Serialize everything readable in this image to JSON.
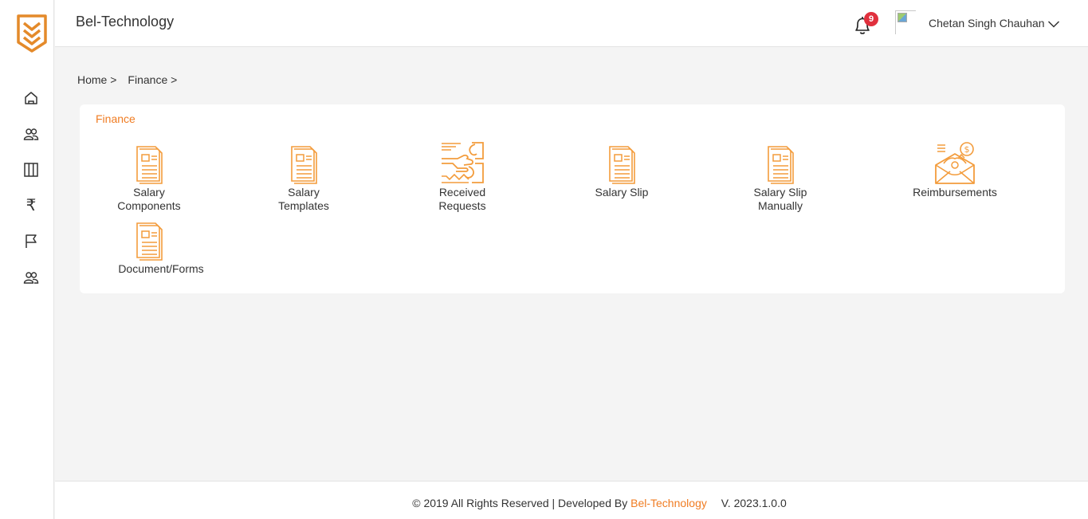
{
  "app": {
    "brand_name": "Bel-Technology",
    "accent_color": "#f07c22",
    "logo_icon": "shield-chevron-logo"
  },
  "sidebar": {
    "items": [
      {
        "name": "home",
        "icon": "home-icon"
      },
      {
        "name": "users",
        "icon": "users-icon"
      },
      {
        "name": "board",
        "icon": "columns-icon"
      },
      {
        "name": "finance",
        "icon": "rupee-icon",
        "glyph": "₹"
      },
      {
        "name": "flag",
        "icon": "flag-icon"
      },
      {
        "name": "team",
        "icon": "team-icon"
      }
    ]
  },
  "header": {
    "notification_count": "9",
    "user_name": "Chetan Singh Chauhan"
  },
  "breadcrumb": {
    "items": [
      "Home >",
      "Finance >"
    ]
  },
  "finance_card": {
    "title": "Finance",
    "tiles": [
      {
        "label": "Salary\nComponents",
        "icon": "document-icon"
      },
      {
        "label": "Salary\nTemplates",
        "icon": "document-icon"
      },
      {
        "label": "Received\nRequests",
        "icon": "handshake-icon"
      },
      {
        "label": "Salary Slip",
        "icon": "document-icon"
      },
      {
        "label": "Salary Slip\nManually",
        "icon": "document-icon"
      },
      {
        "label": "Reimbursements",
        "icon": "money-envelope-icon"
      },
      {
        "label": "Document/Forms",
        "icon": "document-icon"
      }
    ]
  },
  "footer": {
    "copyright": "© 2019 All Rights Reserved | Developed By",
    "developer": "Bel-Technology",
    "version": "V. 2023.1.0.0"
  }
}
